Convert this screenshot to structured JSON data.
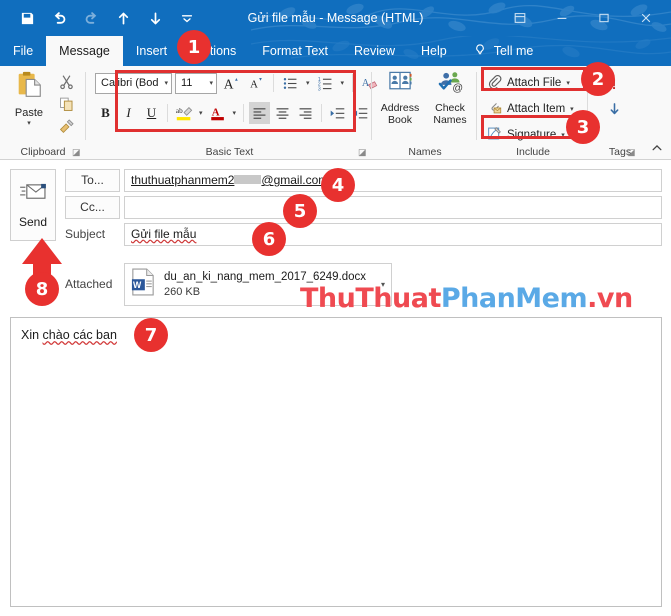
{
  "window": {
    "title": "Gửi file mẫu  -  Message (HTML)",
    "quick_access": [
      {
        "name": "save-icon",
        "label": "Save"
      },
      {
        "name": "undo-icon",
        "label": "Undo"
      },
      {
        "name": "redo-icon",
        "label": "Redo"
      },
      {
        "name": "previous-item-icon",
        "label": "Previous Item"
      },
      {
        "name": "next-item-icon",
        "label": "Next Item"
      },
      {
        "name": "customize-quick-access-icon",
        "label": "Customize Quick Access Toolbar"
      }
    ],
    "controls": [
      {
        "name": "ribbon-display-options-icon",
        "label": "Ribbon Display Options"
      },
      {
        "name": "minimize-icon",
        "label": "Minimize"
      },
      {
        "name": "maximize-icon",
        "label": "Maximize"
      },
      {
        "name": "close-icon",
        "label": "Close"
      }
    ]
  },
  "tabs": [
    {
      "label": "File",
      "active": false
    },
    {
      "label": "Message",
      "active": true
    },
    {
      "label": "Insert",
      "active": false
    },
    {
      "label": "Options",
      "active": false
    },
    {
      "label": "Format Text",
      "active": false
    },
    {
      "label": "Review",
      "active": false
    },
    {
      "label": "Help",
      "active": false
    },
    {
      "label": "Tell me",
      "active": false
    }
  ],
  "ribbon": {
    "clipboard": {
      "group_label": "Clipboard",
      "paste_label": "Paste",
      "cut_label": "Cut",
      "copy_label": "Copy",
      "format_painter_label": "Format Painter"
    },
    "basic_text": {
      "group_label": "Basic Text",
      "font_name": "Calibri (Bod",
      "font_size": "11",
      "grow_font_label": "Increase Font Size",
      "shrink_font_label": "Decrease Font Size",
      "bullets_label": "Bullets",
      "numbering_label": "Numbering",
      "clear_formatting_label": "Clear All Formatting",
      "bold_label": "B",
      "italic_label": "I",
      "underline_label": "U",
      "highlight_label": "Text Highlight Color",
      "font_color_label": "A",
      "align_left_label": "Align Left",
      "align_center_label": "Center",
      "align_right_label": "Align Right",
      "decrease_indent_label": "Decrease Indent",
      "increase_indent_label": "Increase Indent"
    },
    "names": {
      "group_label": "Names",
      "address_book_line1": "Address",
      "address_book_line2": "Book",
      "check_names_line1": "Check",
      "check_names_line2": "Names"
    },
    "include": {
      "group_label": "Include",
      "attach_file_label": "Attach File",
      "attach_item_label": "Attach Item",
      "signature_label": "Signature"
    },
    "tags": {
      "group_label": "Tags",
      "high_importance_label": "High Importance",
      "low_importance_label": "Low Importance"
    },
    "collapse_label": "Collapse the Ribbon"
  },
  "compose": {
    "send_label": "Send",
    "to_label": "To...",
    "cc_label": "Cc...",
    "subject_label": "Subject",
    "attached_label": "Attached",
    "to_value_prefix": "thuthuatphanmem2",
    "to_value_suffix": "@gmail.com",
    "cc_value": "",
    "subject_value": "Gửi file mẫu",
    "attachment": {
      "icon": "word-document-icon",
      "filename": "du_an_ki_nang_mem_2017_6249.docx",
      "size": "260 KB"
    }
  },
  "body": {
    "text_before": "Xin ",
    "text_spellcheck": "chào các ban"
  },
  "watermark": {
    "part_red_1": "ThuThuat",
    "part_blue": "PhanMem",
    "part_red_2": ".vn"
  },
  "annotations": {
    "badges": [
      {
        "num": "1"
      },
      {
        "num": "2"
      },
      {
        "num": "3"
      },
      {
        "num": "4"
      },
      {
        "num": "5"
      },
      {
        "num": "6"
      },
      {
        "num": "7"
      },
      {
        "num": "8"
      }
    ]
  },
  "colors": {
    "title_bar": "#106ebe",
    "accent_red": "#e8312f",
    "watermark_red": "#ef4a51",
    "watermark_blue": "#5aa9e6"
  }
}
